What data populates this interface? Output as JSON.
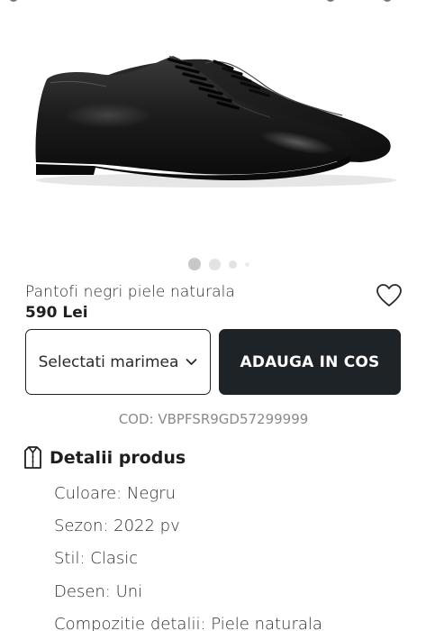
{
  "product": {
    "title": "Pantofi negri piele naturala",
    "price": "590 Lei",
    "code": "COD: VBPFSR9GD57299999",
    "image_icon": "dress-shoe-image",
    "wishlist_icon": "heart-icon"
  },
  "gallery": {
    "slides": 4,
    "active_slide": 1
  },
  "actions": {
    "size_select_label": "Selectati marimea",
    "add_to_cart_label": "ADAUGA IN COS"
  },
  "details": {
    "heading": "Detalii produs",
    "heading_icon": "shirt-tag-icon",
    "specs": [
      "Culoare: Negru",
      "Sezon: 2022 pv",
      "Stil: Clasic",
      "Desen: Uni",
      "Compozitie detalii: Piele naturala"
    ]
  },
  "colors": {
    "button_dark": "#1d2327",
    "code_gray": "#8a8a8a"
  }
}
